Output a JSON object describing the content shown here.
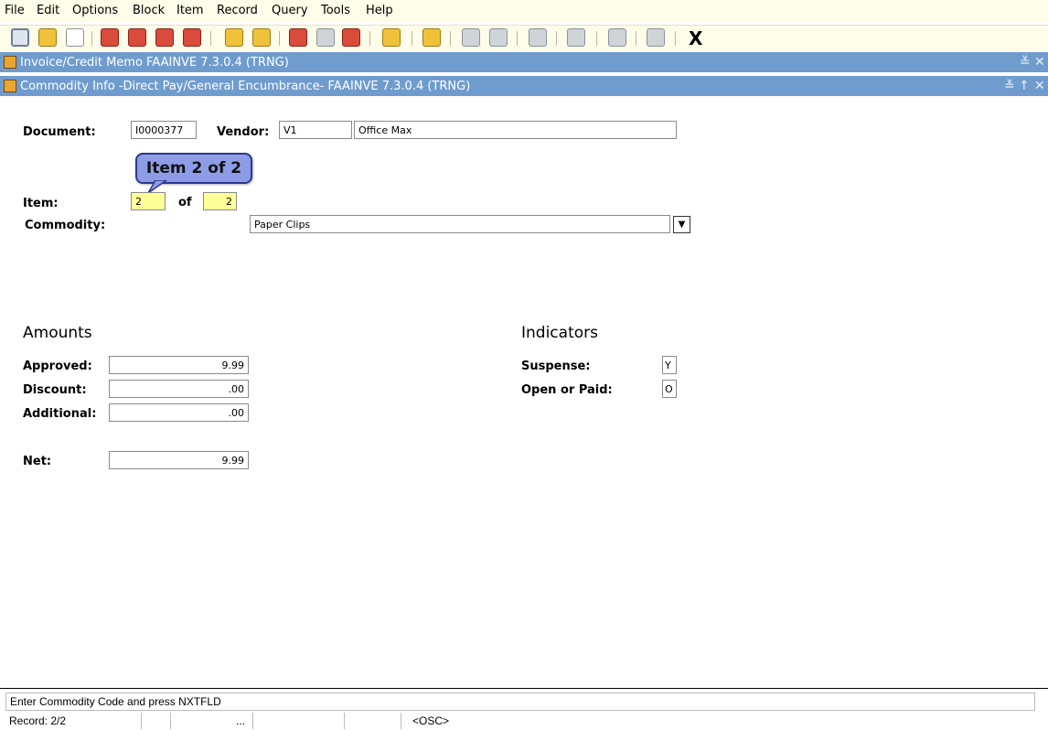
{
  "menu": [
    "File",
    "Edit",
    "Options",
    "Block",
    "Item",
    "Record",
    "Query",
    "Tools",
    "Help"
  ],
  "toolbar": {
    "exit_label": "X"
  },
  "windows": {
    "outer_title": "Invoice/Credit Memo  FAAINVE  7.3.0.4  (TRNG)",
    "inner_title": "Commodity Info -Direct Pay/General Encumbrance-  FAAINVE  7.3.0.4  (TRNG)"
  },
  "form": {
    "document_label": "Document:",
    "document_value": "I0000377",
    "vendor_label": "Vendor:",
    "vendor_id": "V1",
    "vendor_name": "Office Max",
    "item_label": "Item:",
    "item_value": "2",
    "of_label": "of",
    "item_total": "2",
    "commodity_label": "Commodity:",
    "commodity_value": "Paper Clips"
  },
  "callout": "Item 2 of 2",
  "amounts": {
    "header": "Amounts",
    "approved_label": "Approved:",
    "approved_value": "9.99",
    "discount_label": "Discount:",
    "discount_value": ".00",
    "additional_label": "Additional:",
    "additional_value": ".00",
    "net_label": "Net:",
    "net_value": "9.99"
  },
  "indicators": {
    "header": "Indicators",
    "suspense_label": "Suspense:",
    "suspense_value": "Y",
    "open_paid_label": "Open or Paid:",
    "open_paid_value": "O"
  },
  "status": {
    "message": "Enter Commodity Code and press NXTFLD",
    "record": "Record: 2/2",
    "ellipsis": "...",
    "osc": "<OSC>"
  },
  "colors": {
    "titlebar": "#6f9ccd",
    "highlight_field": "#ffff99",
    "callout_fill": "#8e9ce8"
  }
}
